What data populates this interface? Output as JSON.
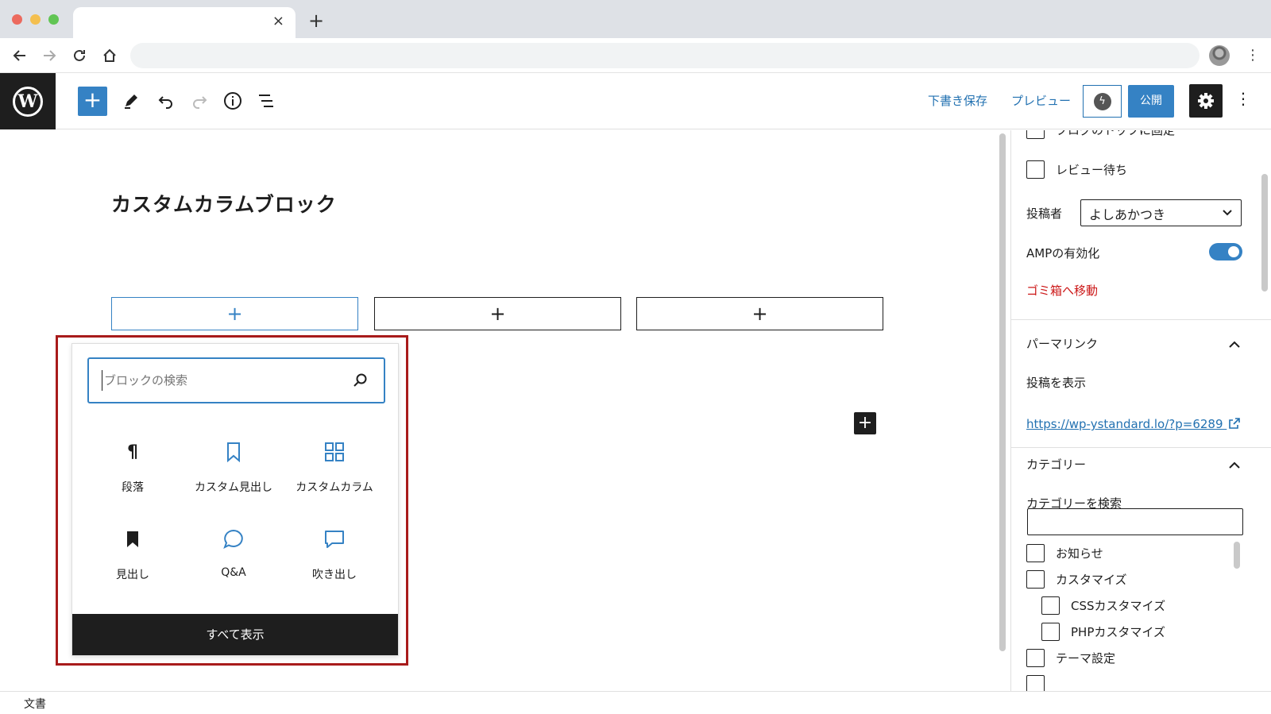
{
  "browser": {
    "tab_close_glyph": "×",
    "new_tab_glyph": "+"
  },
  "toolbar": {
    "save_draft": "下書き保存",
    "preview": "プレビュー",
    "publish": "公開"
  },
  "post": {
    "title": "カスタムカラムブロック"
  },
  "columns": [
    {
      "glyph": "+"
    },
    {
      "glyph": "+"
    },
    {
      "glyph": "+"
    }
  ],
  "inserter": {
    "search_placeholder": "ブロックの検索",
    "search_value": "",
    "blocks": [
      {
        "label": "段落",
        "icon": "paragraph-icon"
      },
      {
        "label": "カスタム見出し",
        "icon": "bookmark-outline-icon"
      },
      {
        "label": "カスタムカラム",
        "icon": "grid-icon"
      },
      {
        "label": "見出し",
        "icon": "bookmark-filled-icon"
      },
      {
        "label": "Q&A",
        "icon": "speech-bubble-round-icon"
      },
      {
        "label": "吹き出し",
        "icon": "speech-bubble-square-icon"
      }
    ],
    "show_all": "すべて表示"
  },
  "sidebar": {
    "sticky_label": "ブログのトップに固定",
    "pending_review": "レビュー待ち",
    "author_label": "投稿者",
    "author_value": "よしあかつき",
    "amp_label": "AMPの有効化",
    "amp_enabled": true,
    "trash": "ゴミ箱へ移動",
    "permalink_title": "パーマリンク",
    "view_post": "投稿を表示",
    "permalink_url": "https://wp-ystandard.lo/?p=6289",
    "category_title": "カテゴリー",
    "category_search_label": "カテゴリーを検索",
    "categories": [
      {
        "label": "お知らせ",
        "level": 0
      },
      {
        "label": "カスタマイズ",
        "level": 0
      },
      {
        "label": "CSSカスタマイズ",
        "level": 1
      },
      {
        "label": "PHPカスタマイズ",
        "level": 1
      },
      {
        "label": "テーマ設定",
        "level": 0
      }
    ]
  },
  "footer": {
    "breadcrumb": "文書"
  },
  "colors": {
    "accent": "#3582c4",
    "link": "#2271b1",
    "danger": "#cc1818",
    "highlight_border": "#a81b1b",
    "dark": "#1e1e1e"
  }
}
